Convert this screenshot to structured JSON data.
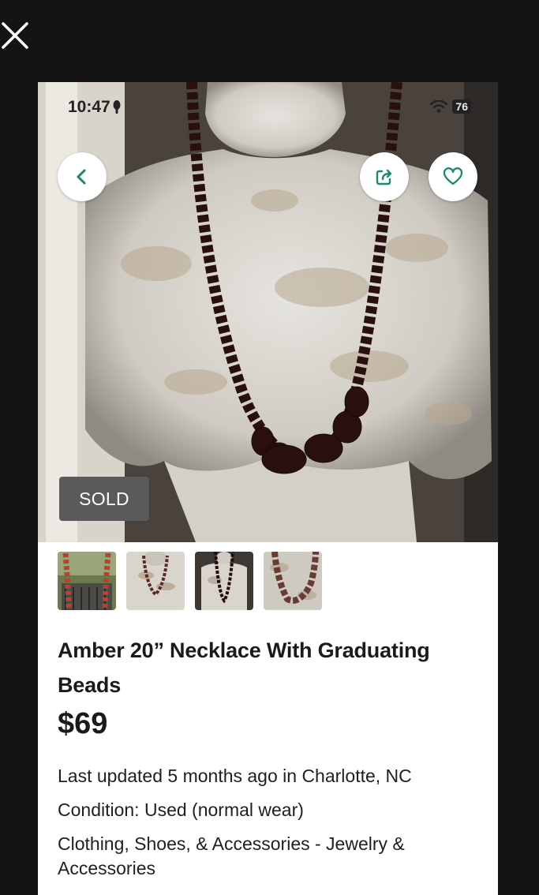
{
  "status_bar": {
    "time": "10:47",
    "battery": "76"
  },
  "listing": {
    "badge": "SOLD",
    "title": "Amber 20” Necklace With Graduating Beads",
    "price": "$69",
    "updated": "Last updated 5 months ago in Charlotte, NC",
    "condition": "Condition: Used (normal wear)",
    "category": "Clothing, Shoes, & Accessories - Jewelry & Accessories"
  },
  "icons": {
    "close": "close-icon",
    "back": "chevron-left-icon",
    "share": "share-icon",
    "favorite": "heart-icon",
    "wifi": "wifi-icon",
    "location": "location-icon"
  },
  "colors": {
    "accent": "#1a8a6e",
    "sold_badge": "#5a5a5a",
    "background": "#141414"
  },
  "thumbnails": [
    {
      "name": "thumbnail-1"
    },
    {
      "name": "thumbnail-2"
    },
    {
      "name": "thumbnail-3"
    },
    {
      "name": "thumbnail-4"
    }
  ]
}
